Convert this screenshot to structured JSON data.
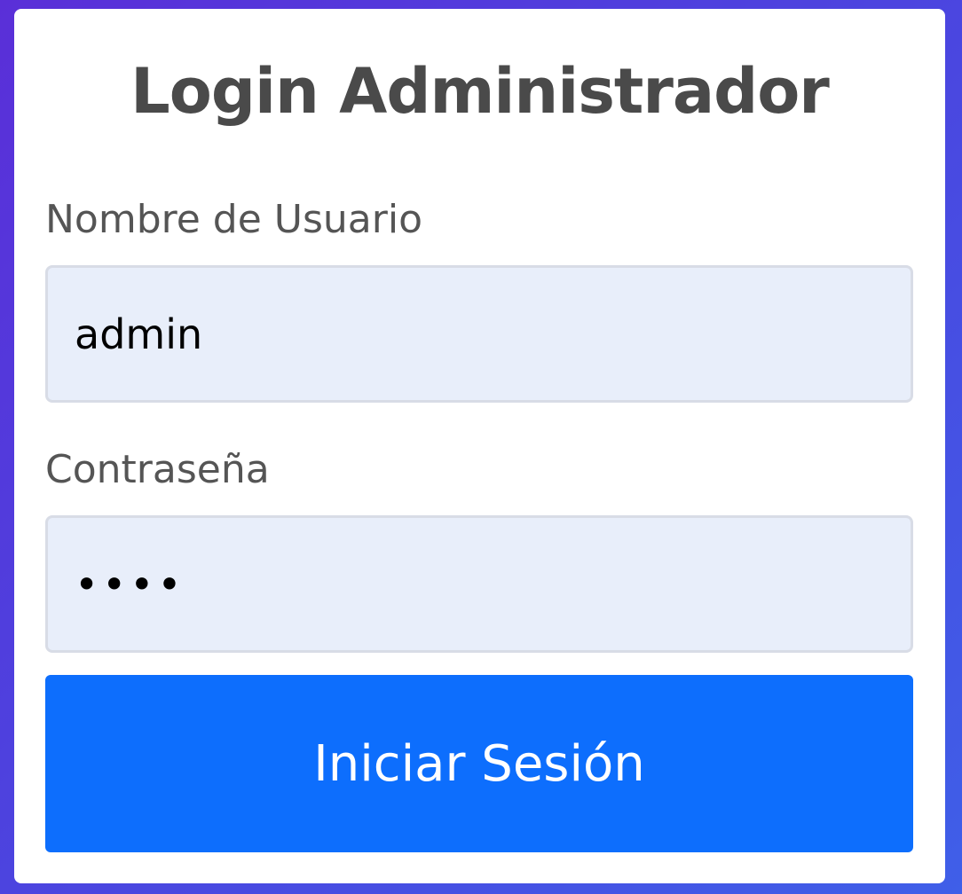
{
  "login": {
    "title": "Login Administrador",
    "username_label": "Nombre de Usuario",
    "username_value": "admin",
    "password_label": "Contraseña",
    "password_value": "1234",
    "submit_label": "Iniciar Sesión"
  },
  "colors": {
    "background_start": "#5a2fd8",
    "background_end": "#3f5fe8",
    "card": "#ffffff",
    "input_background": "#e8eefa",
    "input_border": "#d8dce6",
    "button": "#0d6efd",
    "text": "#4a4a4a"
  }
}
